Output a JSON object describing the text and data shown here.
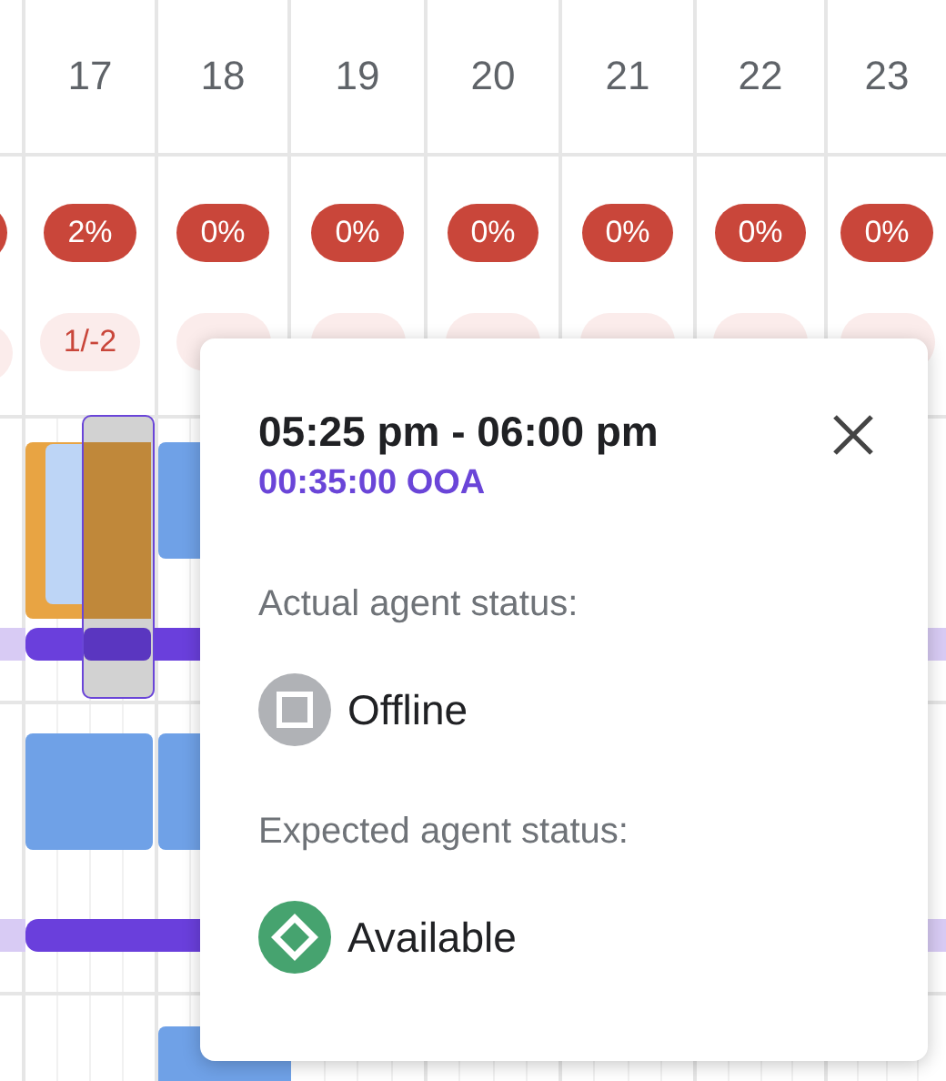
{
  "days": [
    {
      "label": "17",
      "percent": "2%",
      "fraction": "1/-2"
    },
    {
      "label": "18",
      "percent": "0%"
    },
    {
      "label": "19",
      "percent": "0%"
    },
    {
      "label": "20",
      "percent": "0%"
    },
    {
      "label": "21",
      "percent": "0%"
    },
    {
      "label": "22",
      "percent": "0%"
    },
    {
      "label": "23",
      "percent": "0%"
    }
  ],
  "popover": {
    "time_range": "05:25 pm - 06:00 pm",
    "duration": "00:35:00 OOA",
    "sections": [
      {
        "heading": "Actual agent status:",
        "status": {
          "kind": "offline",
          "label": "Offline"
        }
      },
      {
        "heading": "Expected agent status:",
        "status": {
          "kind": "available",
          "label": "Available"
        }
      }
    ]
  }
}
